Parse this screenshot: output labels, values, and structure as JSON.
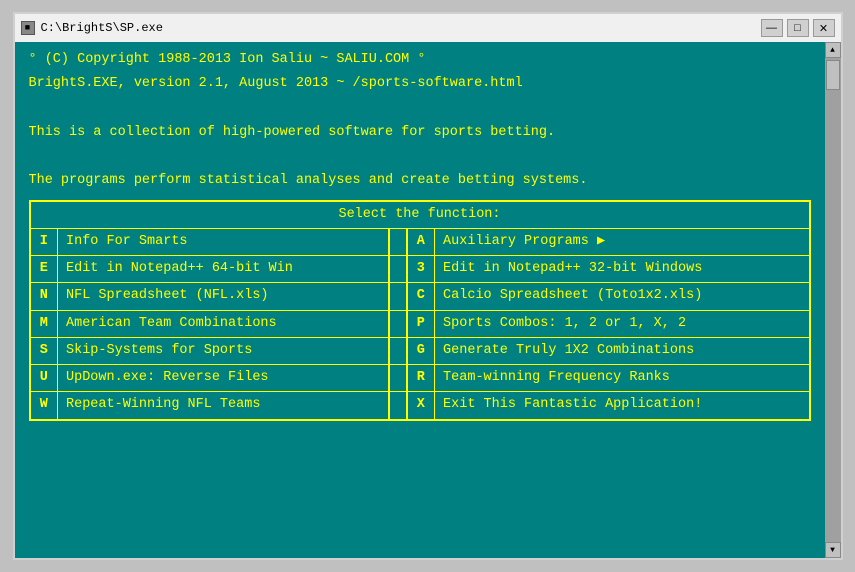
{
  "titlebar": {
    "icon": "■",
    "title": "C:\\BrightS\\SP.exe",
    "minimize": "—",
    "maximize": "□",
    "close": "✕"
  },
  "intro": {
    "line1": "° (C) Copyright 1988-2013 Ion Saliu ~ SALIU.COM °",
    "line2": "BrightS.EXE, version 2.1, August 2013 ~ /sports-software.html",
    "line3": "",
    "line4": "This is a collection of high-powered software for sports betting.",
    "line5": "",
    "line6": "The programs perform statistical analyses and create betting systems."
  },
  "menu": {
    "header": "Select the function:",
    "rows": [
      {
        "key1": "I",
        "label1": "Info For Smarts",
        "key2": "A",
        "label2": "Auxiliary Programs ▶"
      },
      {
        "key1": "E",
        "label1": "Edit in Notepad++ 64-bit Win",
        "key2": "3",
        "label2": "Edit in Notepad++ 32-bit Windows"
      },
      {
        "key1": "N",
        "label1": "NFL Spreadsheet (NFL.xls)",
        "key2": "C",
        "label2": "Calcio Spreadsheet (Toto1x2.xls)"
      },
      {
        "key1": "M",
        "label1": "American Team Combinations",
        "key2": "P",
        "label2": "Sports Combos:  1, 2 or 1, X, 2"
      },
      {
        "key1": "S",
        "label1": "Skip-Systems for Sports",
        "key2": "G",
        "label2": "Generate Truly 1X2 Combinations"
      },
      {
        "key1": "U",
        "label1": "UpDown.exe: Reverse Files",
        "key2": "R",
        "label2": "Team-winning Frequency Ranks"
      },
      {
        "key1": "W",
        "label1": "Repeat-Winning NFL Teams",
        "key2": "X",
        "label2": "Exit This Fantastic Application!"
      }
    ]
  },
  "scrollbar": {
    "up_arrow": "▲",
    "down_arrow": "▼"
  }
}
